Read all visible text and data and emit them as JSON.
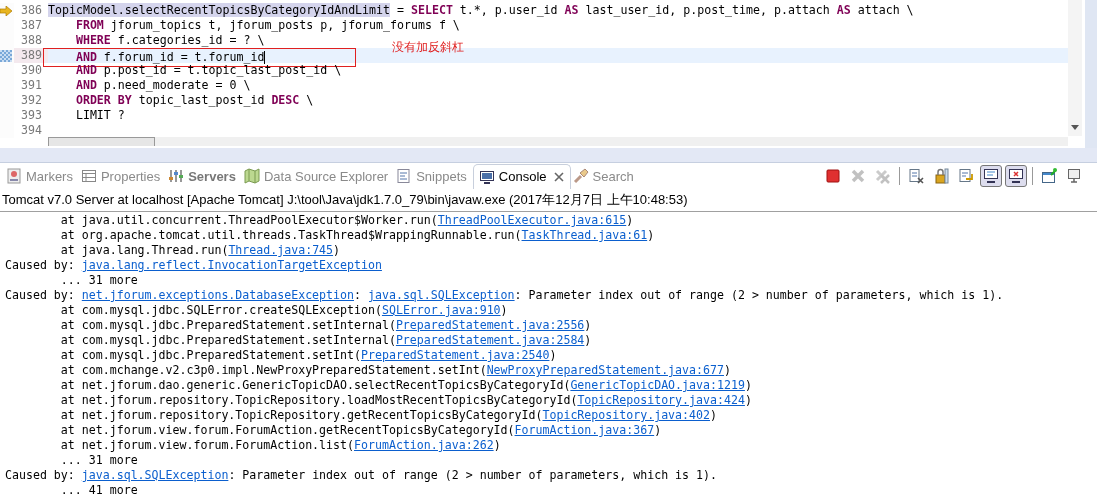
{
  "editor": {
    "lines": [
      {
        "number": "386",
        "current": false,
        "debug_arrow": true,
        "changed": false,
        "segments": [
          {
            "text": "TopicModel.selectRecentTopicsByCategoryIdAndLimit",
            "kind": "occurrence"
          },
          {
            "text": " = ",
            "kind": "plain"
          },
          {
            "text": "SELECT",
            "kind": "keyword"
          },
          {
            "text": " t.*, p.user_id ",
            "kind": "plain"
          },
          {
            "text": "AS",
            "kind": "keyword"
          },
          {
            "text": " last_user_id, p.post_time, p.attach ",
            "kind": "plain"
          },
          {
            "text": "AS",
            "kind": "keyword"
          },
          {
            "text": " attach \\",
            "kind": "plain"
          }
        ]
      },
      {
        "number": "387",
        "current": false,
        "debug_arrow": false,
        "changed": false,
        "segments": [
          {
            "text": "    FROM",
            "kind": "keyword"
          },
          {
            "text": " jforum_topics t, jforum_posts p, jforum_forums f \\",
            "kind": "plain"
          }
        ]
      },
      {
        "number": "388",
        "current": false,
        "debug_arrow": false,
        "changed": false,
        "segments": [
          {
            "text": "    WHERE",
            "kind": "keyword"
          },
          {
            "text": " f.categories_id = ? \\",
            "kind": "plain"
          }
        ]
      },
      {
        "number": "389",
        "current": true,
        "debug_arrow": false,
        "changed": true,
        "segments": [
          {
            "text": "    AND",
            "kind": "keyword"
          },
          {
            "text": " f.forum_id = t.forum_id",
            "kind": "plain"
          }
        ]
      },
      {
        "number": "390",
        "current": false,
        "debug_arrow": false,
        "changed": false,
        "segments": [
          {
            "text": "    AND",
            "kind": "keyword"
          },
          {
            "text": " p.post_id = t.topic_last_post_id \\",
            "kind": "plain"
          }
        ]
      },
      {
        "number": "391",
        "current": false,
        "debug_arrow": false,
        "changed": false,
        "segments": [
          {
            "text": "    AND",
            "kind": "keyword"
          },
          {
            "text": " p.need_moderate = 0 \\",
            "kind": "plain"
          }
        ]
      },
      {
        "number": "392",
        "current": false,
        "debug_arrow": false,
        "changed": false,
        "segments": [
          {
            "text": "    ORDER BY",
            "kind": "keyword"
          },
          {
            "text": " topic_last_post_id ",
            "kind": "plain"
          },
          {
            "text": "DESC",
            "kind": "keyword"
          },
          {
            "text": " \\",
            "kind": "plain"
          }
        ]
      },
      {
        "number": "393",
        "current": false,
        "debug_arrow": false,
        "changed": false,
        "segments": [
          {
            "text": "    LIMIT ?",
            "kind": "plain"
          }
        ]
      },
      {
        "number": "394",
        "current": false,
        "debug_arrow": false,
        "changed": false
      }
    ],
    "annotation": {
      "text": "没有加反斜杠"
    }
  },
  "tabs": [
    {
      "label": "Markers",
      "selected": false,
      "bold": false
    },
    {
      "label": "Properties",
      "selected": false,
      "bold": false
    },
    {
      "label": "Servers",
      "selected": false,
      "bold": true
    },
    {
      "label": "Data Source Explorer",
      "selected": false,
      "bold": false
    },
    {
      "label": "Snippets",
      "selected": false,
      "bold": false
    },
    {
      "label": "Console",
      "selected": true,
      "bold": false
    },
    {
      "label": "Search",
      "selected": false,
      "bold": false
    }
  ],
  "toolbar": [
    {
      "pressed": false,
      "disabled": false
    },
    {
      "pressed": false,
      "disabled": true
    },
    {
      "pressed": false,
      "disabled": true
    },
    {
      "pressed": false,
      "disabled": false
    },
    {
      "pressed": false,
      "disabled": false
    },
    {
      "pressed": false,
      "disabled": false
    },
    {
      "pressed": true,
      "disabled": false
    },
    {
      "pressed": true,
      "disabled": false
    },
    {
      "pressed": false,
      "disabled": false
    },
    {
      "pressed": false,
      "disabled": false
    }
  ],
  "console": {
    "header": "Tomcat v7.0 Server at localhost [Apache Tomcat] J:\\tool\\Java\\jdk1.7.0_79\\bin\\javaw.exe (2017年12月7日 上午10:48:53)",
    "lines": [
      [
        {
          "text": "\tat java.util.concurrent.ThreadPoolExecutor$Worker.run(",
          "link": false
        },
        {
          "text": "ThreadPoolExecutor.java:615",
          "link": true
        },
        {
          "text": ")",
          "link": false
        }
      ],
      [
        {
          "text": "\tat org.apache.tomcat.util.threads.TaskThread$WrappingRunnable.run(",
          "link": false
        },
        {
          "text": "TaskThread.java:61",
          "link": true
        },
        {
          "text": ")",
          "link": false
        }
      ],
      [
        {
          "text": "\tat java.lang.Thread.run(",
          "link": false
        },
        {
          "text": "Thread.java:745",
          "link": true
        },
        {
          "text": ")",
          "link": false
        }
      ],
      [
        {
          "text": "Caused by: ",
          "link": false
        },
        {
          "text": "java.lang.reflect.InvocationTargetException",
          "link": true
        }
      ],
      [
        {
          "text": "\t... 31 more",
          "link": false
        }
      ],
      [
        {
          "text": "Caused by: ",
          "link": false
        },
        {
          "text": "net.jforum.exceptions.DatabaseException",
          "link": true
        },
        {
          "text": ": ",
          "link": false
        },
        {
          "text": "java.sql.SQLException",
          "link": true
        },
        {
          "text": ": Parameter index out of range (2 > number of parameters, which is 1).",
          "link": false
        }
      ],
      [
        {
          "text": "\tat com.mysql.jdbc.SQLError.createSQLException(",
          "link": false
        },
        {
          "text": "SQLError.java:910",
          "link": true
        },
        {
          "text": ")",
          "link": false
        }
      ],
      [
        {
          "text": "\tat com.mysql.jdbc.PreparedStatement.setInternal(",
          "link": false
        },
        {
          "text": "PreparedStatement.java:2556",
          "link": true
        },
        {
          "text": ")",
          "link": false
        }
      ],
      [
        {
          "text": "\tat com.mysql.jdbc.PreparedStatement.setInternal(",
          "link": false
        },
        {
          "text": "PreparedStatement.java:2584",
          "link": true
        },
        {
          "text": ")",
          "link": false
        }
      ],
      [
        {
          "text": "\tat com.mysql.jdbc.PreparedStatement.setInt(",
          "link": false
        },
        {
          "text": "PreparedStatement.java:2540",
          "link": true
        },
        {
          "text": ")",
          "link": false
        }
      ],
      [
        {
          "text": "\tat com.mchange.v2.c3p0.impl.NewProxyPreparedStatement.setInt(",
          "link": false
        },
        {
          "text": "NewProxyPreparedStatement.java:677",
          "link": true
        },
        {
          "text": ")",
          "link": false
        }
      ],
      [
        {
          "text": "\tat net.jforum.dao.generic.GenericTopicDAO.selectRecentTopicsByCategoryId(",
          "link": false
        },
        {
          "text": "GenericTopicDAO.java:1219",
          "link": true
        },
        {
          "text": ")",
          "link": false
        }
      ],
      [
        {
          "text": "\tat net.jforum.repository.TopicRepository.loadMostRecentTopicsByCategoryId(",
          "link": false
        },
        {
          "text": "TopicRepository.java:424",
          "link": true
        },
        {
          "text": ")",
          "link": false
        }
      ],
      [
        {
          "text": "\tat net.jforum.repository.TopicRepository.getRecentTopicsByCategoryId(",
          "link": false
        },
        {
          "text": "TopicRepository.java:402",
          "link": true
        },
        {
          "text": ")",
          "link": false
        }
      ],
      [
        {
          "text": "\tat net.jforum.view.forum.ForumAction.getRecentTopicsByCategoryId(",
          "link": false
        },
        {
          "text": "ForumAction.java:367",
          "link": true
        },
        {
          "text": ")",
          "link": false
        }
      ],
      [
        {
          "text": "\tat net.jforum.view.forum.ForumAction.list(",
          "link": false
        },
        {
          "text": "ForumAction.java:262",
          "link": true
        },
        {
          "text": ")",
          "link": false
        }
      ],
      [
        {
          "text": "\t... 31 more",
          "link": false
        }
      ],
      [
        {
          "text": "Caused by: ",
          "link": false
        },
        {
          "text": "java.sql.SQLException",
          "link": true
        },
        {
          "text": ": Parameter index out of range (2 > number of parameters, which is 1).",
          "link": false
        }
      ],
      [
        {
          "text": "\t... 41 more",
          "link": false
        }
      ]
    ]
  }
}
